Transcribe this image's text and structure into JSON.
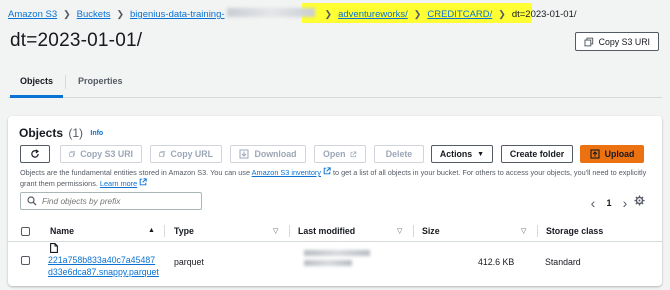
{
  "breadcrumb": {
    "items": [
      "Amazon S3",
      "Buckets",
      "bigenius-data-training-",
      "adventureworks/",
      "CREDITCARD/"
    ],
    "current": "dt=2023-01-01/"
  },
  "page": {
    "title": "dt=2023-01-01/",
    "copy_s3_uri": "Copy S3 URI"
  },
  "tabs": [
    "Objects",
    "Properties"
  ],
  "objects_panel": {
    "title": "Objects",
    "count": "(1)",
    "info": "Info",
    "buttons": {
      "refresh": "",
      "copy_s3_uri": "Copy S3 URI",
      "copy_url": "Copy URL",
      "download": "Download",
      "open": "Open",
      "delete": "Delete",
      "actions": "Actions",
      "create_folder": "Create folder",
      "upload": "Upload"
    },
    "description": {
      "part1": "Objects are the fundamental entities stored in Amazon S3. You can use ",
      "inventory_link": "Amazon S3 inventory",
      "part2": " to get a list of all objects in your bucket. For others to access your objects, you'll need to explicitly grant them permissions. ",
      "learn_more": "Learn more"
    },
    "search_placeholder": "Find objects by prefix",
    "pagination": {
      "prev": "‹",
      "page": "1",
      "next": "›"
    },
    "columns": [
      "Name",
      "Type",
      "Last modified",
      "Size",
      "Storage class"
    ],
    "rows": [
      {
        "name_line1": "221a758b833a40c7a45487",
        "name_line2": "d33e6dca87.snappy.parquet",
        "type": "parquet",
        "size": "412.6 KB",
        "storage_class": "Standard"
      }
    ]
  },
  "colors": {
    "link": "#0972d3",
    "primary": "#ec7211",
    "highlight": "#ffff33",
    "background": "#f2f3f3"
  }
}
